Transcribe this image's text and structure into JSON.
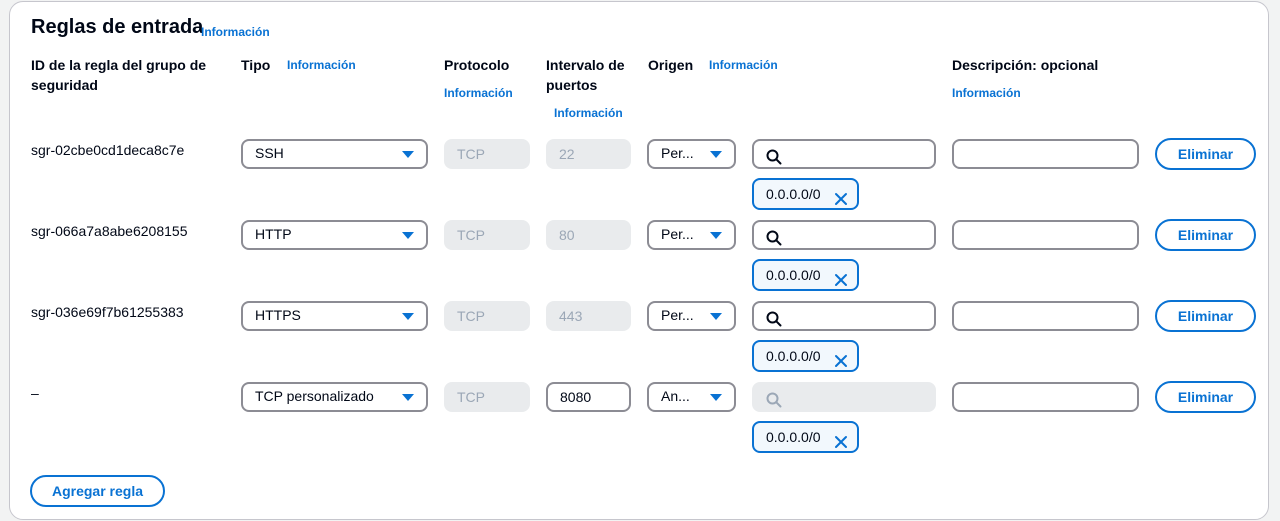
{
  "section": {
    "title": "Reglas de entrada",
    "info": "Información"
  },
  "headers": {
    "id": "ID de la regla del grupo de seguridad",
    "type": "Tipo",
    "type_info": "Información",
    "protocol": "Protocolo",
    "protocol_info": "Información",
    "port_range": "Intervalo de puertos",
    "port_info": "Información",
    "source": "Origen",
    "source_info": "Información",
    "description": "Descripción: opcional",
    "description_info": "Información"
  },
  "rules": [
    {
      "id": "sgr-02cbe0cd1deca8c7e",
      "type": "SSH",
      "protocol": "TCP",
      "port": "22",
      "source_type": "Per...",
      "cidr": "0.0.0.0/0",
      "description": "",
      "delete_label": "Eliminar",
      "search_placeholder": ""
    },
    {
      "id": "sgr-066a7a8abe6208155",
      "type": "HTTP",
      "protocol": "TCP",
      "port": "80",
      "source_type": "Per...",
      "cidr": "0.0.0.0/0",
      "description": "",
      "delete_label": "Eliminar",
      "search_placeholder": ""
    },
    {
      "id": "sgr-036e69f7b61255383",
      "type": "HTTPS",
      "protocol": "TCP",
      "port": "443",
      "source_type": "Per...",
      "cidr": "0.0.0.0/0",
      "description": "",
      "delete_label": "Eliminar",
      "search_placeholder": ""
    },
    {
      "id": "–",
      "type": "TCP personalizado",
      "protocol": "TCP",
      "port": "8080",
      "source_type": "An...",
      "cidr": "0.0.0.0/0",
      "description": "",
      "delete_label": "Eliminar",
      "search_placeholder": ""
    }
  ],
  "add_rule_label": "Agregar regla",
  "colors": {
    "accent": "#0972d3",
    "disabled_bg": "#e9ebed",
    "border": "#8c8c94"
  },
  "icons": {
    "dropdown": "caret-down-icon",
    "search": "search-icon",
    "remove": "close-icon"
  }
}
